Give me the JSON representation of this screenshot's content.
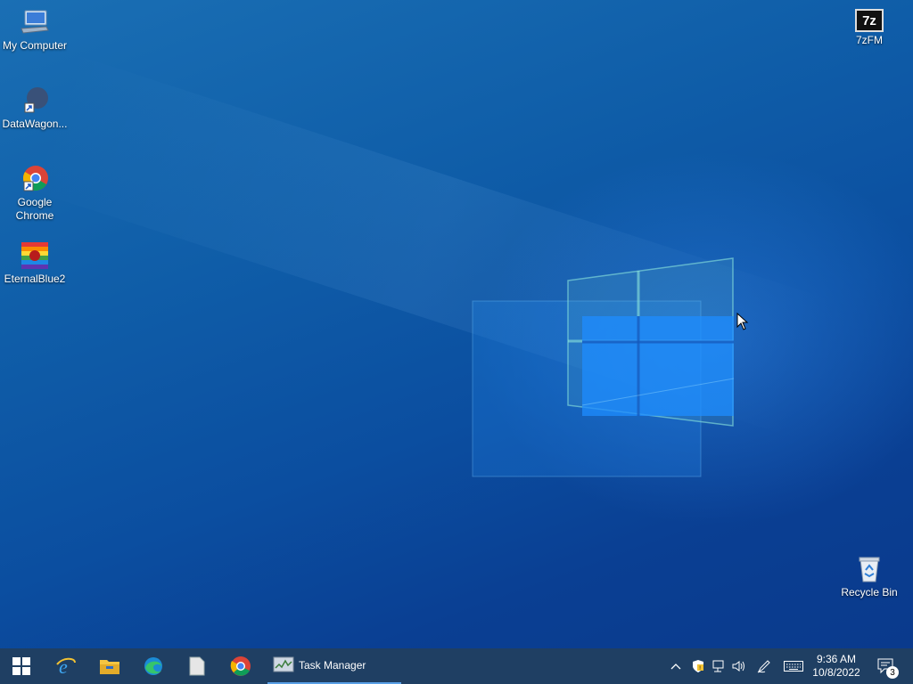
{
  "desktop": {
    "icons_left": [
      {
        "name": "my-computer",
        "label": "My Computer"
      },
      {
        "name": "datawagon",
        "label": "DataWagon..."
      },
      {
        "name": "google-chrome",
        "label": "Google Chrome"
      },
      {
        "name": "eternalblue2",
        "label": "EternalBlue2"
      }
    ],
    "icons_right": [
      {
        "name": "7zfm",
        "label": "7zFM",
        "glyph_text": "7z"
      },
      {
        "name": "recycle-bin",
        "label": "Recycle Bin"
      }
    ]
  },
  "taskbar": {
    "pinned": [
      {
        "name": "start",
        "icon": "windows-icon"
      },
      {
        "name": "internet-explorer",
        "icon": "ie-icon"
      },
      {
        "name": "file-explorer",
        "icon": "folder-icon"
      },
      {
        "name": "edge",
        "icon": "edge-icon"
      },
      {
        "name": "notepad",
        "icon": "file-icon"
      },
      {
        "name": "chrome",
        "icon": "chrome-icon"
      }
    ],
    "running_app": {
      "label": "Task Manager",
      "icon": "task-manager-icon"
    },
    "tray": {
      "icons": [
        "chevron-up-icon",
        "security-icon",
        "network-icon",
        "volume-icon",
        "pen-icon",
        "keyboard-icon"
      ],
      "time": "9:36 AM",
      "date": "10/8/2022",
      "notifications_count": "3"
    }
  },
  "colors": {
    "taskbar": "#1f3f63",
    "desktop_top": "#1a6fb4",
    "desktop_bottom": "#0a3a8c",
    "accent_blue": "#1e90ff"
  }
}
